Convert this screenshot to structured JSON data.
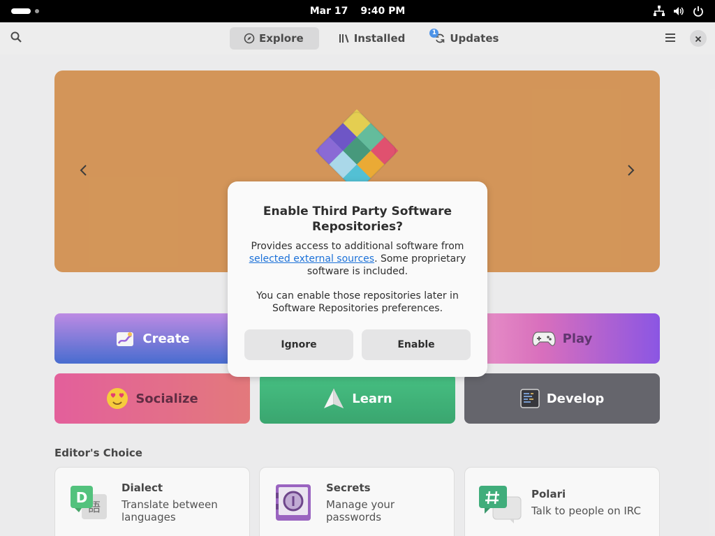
{
  "top_bar": {
    "date": "Mar 17",
    "time": "9:40 PM",
    "icons": [
      "network-icon",
      "volume-icon",
      "power-icon"
    ]
  },
  "header": {
    "tabs": [
      {
        "label": "Explore",
        "icon": "compass-icon",
        "active": true
      },
      {
        "label": "Installed",
        "icon": "library-icon",
        "active": false
      },
      {
        "label": "Updates",
        "icon": "refresh-icon",
        "active": false,
        "badge": "1"
      }
    ]
  },
  "categories": [
    {
      "label": "Create",
      "icon": "create-icon"
    },
    {
      "label": "Play",
      "icon": "gamepad-icon"
    },
    {
      "label": "Socialize",
      "icon": "smiley-icon"
    },
    {
      "label": "Learn",
      "icon": "paper-plane-icon"
    },
    {
      "label": "Develop",
      "icon": "terminal-icon"
    }
  ],
  "editors_choice": {
    "title": "Editor's Choice",
    "apps": [
      {
        "name": "Dialect",
        "description": "Translate between languages",
        "icon": "dialect-icon"
      },
      {
        "name": "Secrets",
        "description": "Manage your passwords",
        "icon": "secrets-icon"
      },
      {
        "name": "Polari",
        "description": "Talk to people on IRC",
        "icon": "polari-icon"
      }
    ]
  },
  "dialog": {
    "title": "Enable Third Party Software Repositories?",
    "body_prefix": "Provides access to additional software from ",
    "body_link": "selected external sources",
    "body_suffix": ". Some proprietary software is included.",
    "body2": "You can enable those repositories later in Software Repositories preferences.",
    "ignore_label": "Ignore",
    "enable_label": "Enable"
  },
  "colors": {
    "banner": "#cd8742",
    "accent": "#3584e4",
    "link": "#1c71d8"
  }
}
